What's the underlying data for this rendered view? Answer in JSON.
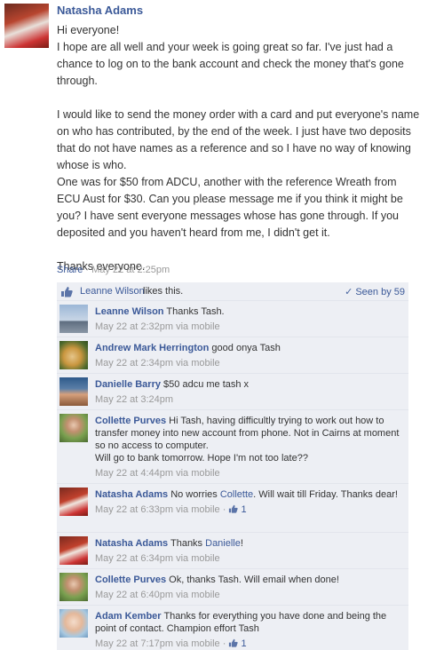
{
  "post": {
    "author": "Natasha Adams",
    "body": "Hi everyone!\nI hope are all well and your week is going great so far. I've just had a chance to log on to the bank account and check the money that's gone through.\n\nI would like to send the money order with a card and put everyone's name on who has contributed, by the end of the week. I just have two deposits that do not have names as a reference and so I have no way of knowing whose is who.\nOne was for $50 from ADCU, another with the reference Wreath from ECU Aust for $30. Can you please message me if you think it might be you? I have sent everyone messages whose has gone through. If you deposited and you haven't heard from me, I didn't get it.\n\nThanks everyone.",
    "share_label": "Share",
    "separator": " · ",
    "timestamp": "May 22 at 2:25pm"
  },
  "likes": {
    "liker": "Leanne Wilson",
    "text": "likes this.",
    "seen_by": "Seen by 59"
  },
  "comments": [
    {
      "author": "Leanne Wilson",
      "text": "Thanks Tash.",
      "meta": "May 22 at 2:32pm via mobile"
    },
    {
      "author": "Andrew Mark Herrington",
      "text": "good onya Tash",
      "meta": "May 22 at 2:34pm via mobile"
    },
    {
      "author": "Danielle Barry",
      "text": "$50 adcu me tash x",
      "meta": "May 22 at 3:24pm"
    },
    {
      "author": "Collette Purves",
      "text": "Hi Tash, having difficultly trying to work out how to transfer money into new account from phone. Not in Cairns at moment so no access to computer.",
      "text2": "Will go to bank tomorrow. Hope I'm not too late??",
      "meta": "May 22 at 4:44pm via mobile"
    },
    {
      "author": "Natasha Adams",
      "text": "No worries",
      "mention": "Collette",
      "text_after": ". Will wait till Friday. Thanks dear!",
      "meta": "May 22 at 6:33pm via mobile",
      "likes_count": "1"
    },
    {
      "author": "Natasha Adams",
      "text": "Thanks",
      "mention": "Danielle",
      "text_after": "!",
      "meta": "May 22 at 6:34pm via mobile"
    },
    {
      "author": "Collette Purves",
      "text": "Ok, thanks Tash. Will email when done!",
      "meta": "May 22 at 6:40pm via mobile"
    },
    {
      "author": "Adam Kember",
      "text": "Thanks for everything you have done and being the point of contact. Champion effort Tash",
      "meta": "May 22 at 7:17pm via mobile",
      "likes_count": "1"
    }
  ]
}
